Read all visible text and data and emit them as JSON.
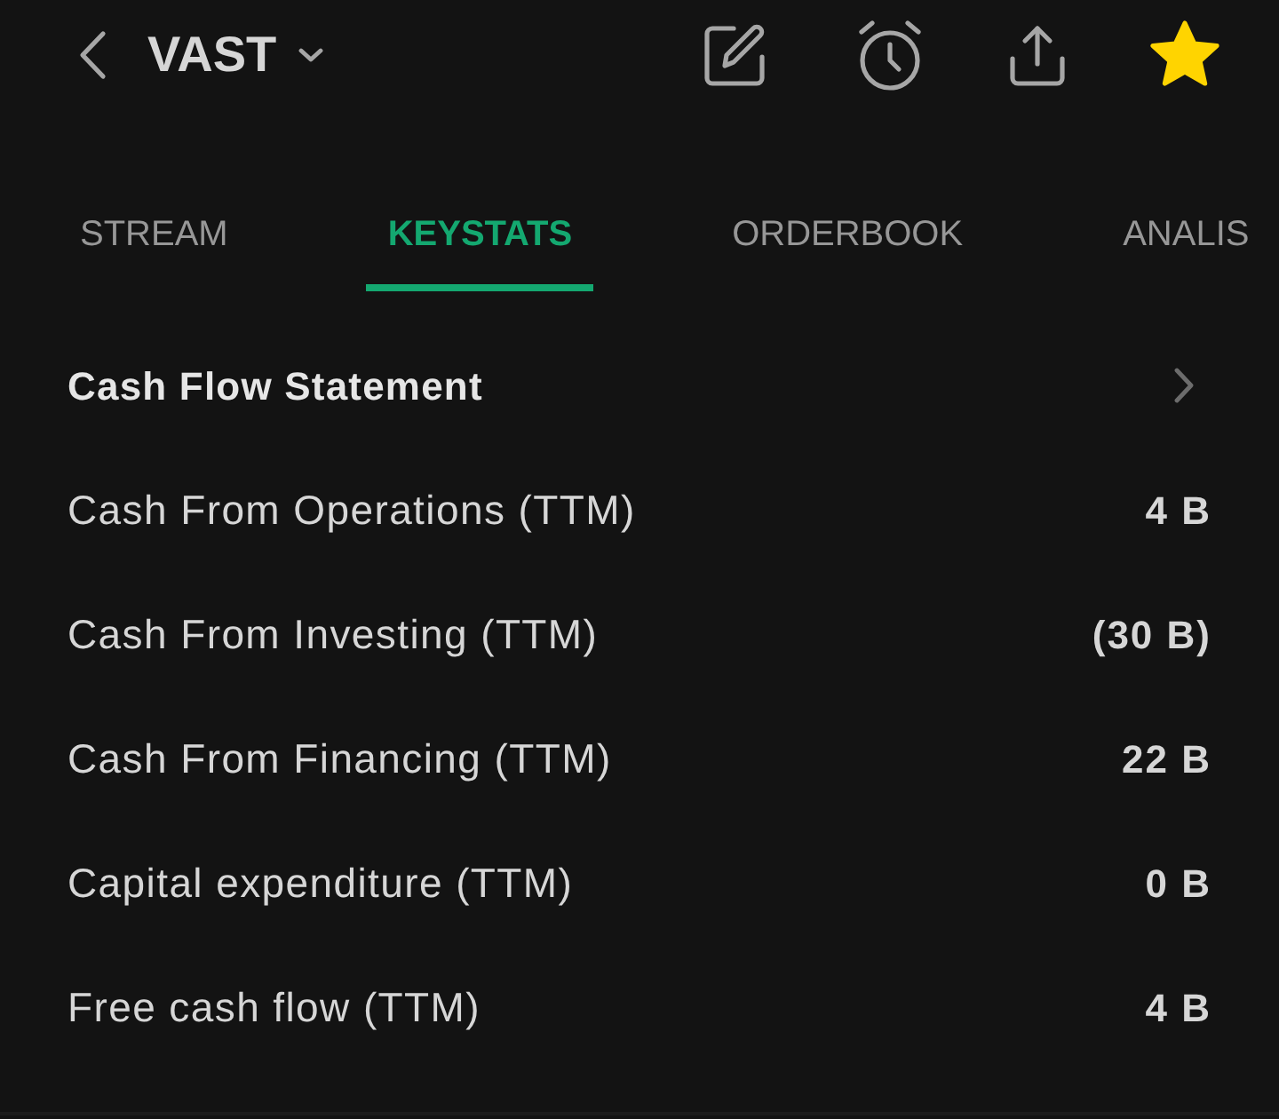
{
  "header": {
    "ticker": "VAST",
    "favorite": true
  },
  "tabs": [
    {
      "label": "STREAM",
      "selected": false
    },
    {
      "label": "KEYSTATS",
      "selected": true
    },
    {
      "label": "ORDERBOOK",
      "selected": false
    },
    {
      "label": "ANALIS",
      "selected": false
    }
  ],
  "section": {
    "title": "Cash Flow Statement",
    "rows": [
      {
        "label": "Cash From Operations (TTM)",
        "value": "4 B"
      },
      {
        "label": "Cash From Investing (TTM)",
        "value": "(30 B)"
      },
      {
        "label": "Cash From Financing (TTM)",
        "value": "22 B"
      },
      {
        "label": "Capital expenditure (TTM)",
        "value": "0 B"
      },
      {
        "label": "Free cash flow (TTM)",
        "value": "4 B"
      }
    ]
  }
}
